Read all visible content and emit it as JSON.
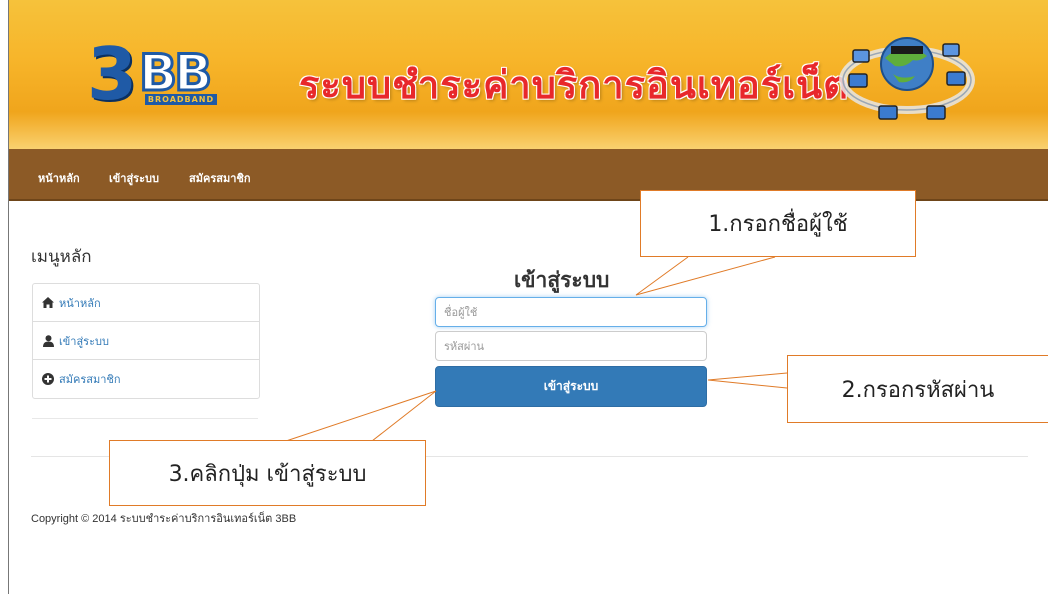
{
  "banner": {
    "logo_text": "3BB",
    "logo_sub": "BROADBAND",
    "title": "ระบบชำระค่าบริการอินเทอร์เน็ต",
    "brand_color": "#e8282b"
  },
  "nav": {
    "items": [
      {
        "label": "หน้าหลัก"
      },
      {
        "label": "เข้าสู่ระบบ"
      },
      {
        "label": "สมัครสมาชิก"
      }
    ]
  },
  "sidebar": {
    "title": "เมนูหลัก",
    "items": [
      {
        "label": "หน้าหลัก",
        "icon": "home-icon"
      },
      {
        "label": "เข้าสู่ระบบ",
        "icon": "user-icon"
      },
      {
        "label": "สมัครสมาชิก",
        "icon": "plus-circle-icon"
      }
    ]
  },
  "login": {
    "title": "เข้าสู่ระบบ",
    "username_placeholder": "ชื่อผู้ใช้",
    "password_placeholder": "รหัสผ่าน",
    "button_label": "เข้าสู่ระบบ",
    "button_color": "#337ab7"
  },
  "footer": {
    "copyright": "Copyright © 2014 ระบบชำระค่าบริการอินเทอร์เน็ต 3BB"
  },
  "callouts": {
    "step1": "1.กรอกชื่อผู้ใช้",
    "step2": "2.กรอกรหัสผ่าน",
    "step3": "3.คลิกปุ่ม เข้าสู่ระบบ",
    "border_color": "#e07b28"
  }
}
